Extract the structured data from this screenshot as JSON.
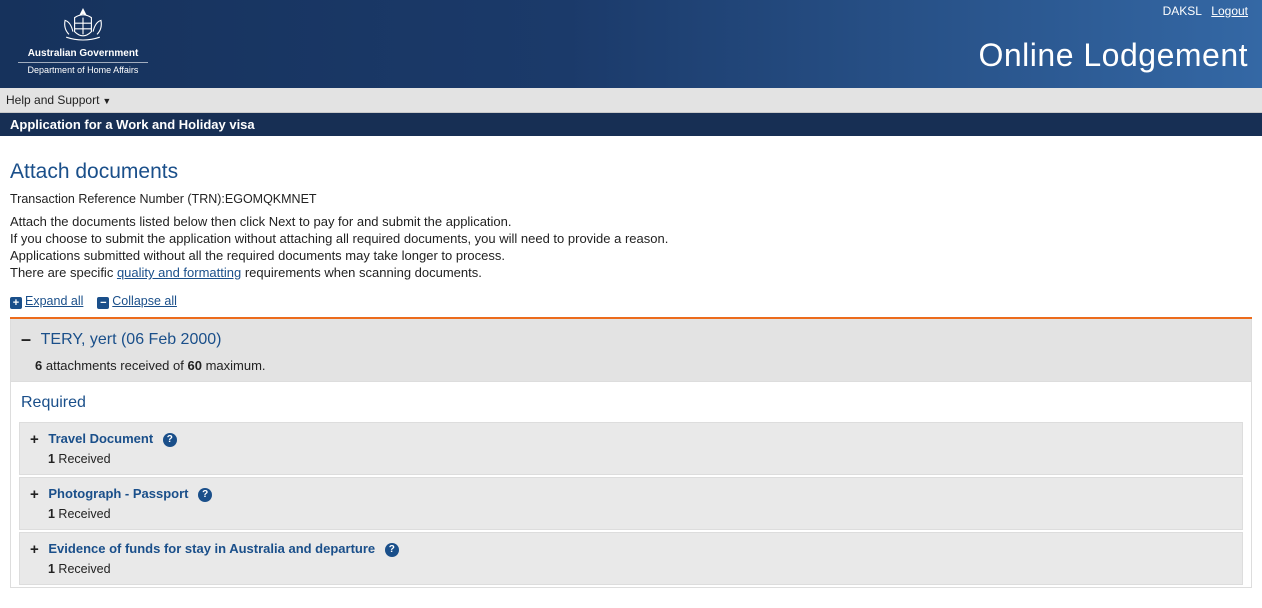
{
  "header": {
    "username": "DAKSL",
    "logout": "Logout",
    "gov_line": "Australian Government",
    "dept_line": "Department of Home Affairs",
    "app_title": "Online Lodgement"
  },
  "toolbar": {
    "help_label": "Help and Support"
  },
  "titlebar": {
    "text": "Application for a Work and Holiday visa"
  },
  "page": {
    "heading": "Attach documents",
    "trn_label": "Transaction Reference Number (TRN):",
    "trn_value": "EGOMQKMNET",
    "p1": "Attach the documents listed below then click Next to pay for and submit the application.",
    "p2": "If you choose to submit the application without attaching all required documents, you will need to provide a reason.",
    "p3": "Applications submitted without all the required documents may take longer to process.",
    "p4a": "There are specific ",
    "p4_link": "quality and formatting",
    "p4b": " requirements when scanning documents.",
    "expand_all": "Expand all",
    "collapse_all": "Collapse all"
  },
  "person": {
    "name": "TERY, yert (06 Feb 2000)",
    "count_received": "6",
    "count_mid": " attachments received of ",
    "count_max": "60",
    "count_suffix": " maximum."
  },
  "required": {
    "heading": "Required",
    "items": [
      {
        "title": "Travel Document",
        "received": "1",
        "rcv_label": " Received"
      },
      {
        "title": "Photograph - Passport",
        "received": "1",
        "rcv_label": " Received"
      },
      {
        "title": "Evidence of funds for stay in Australia and departure",
        "received": "1",
        "rcv_label": " Received"
      }
    ]
  }
}
